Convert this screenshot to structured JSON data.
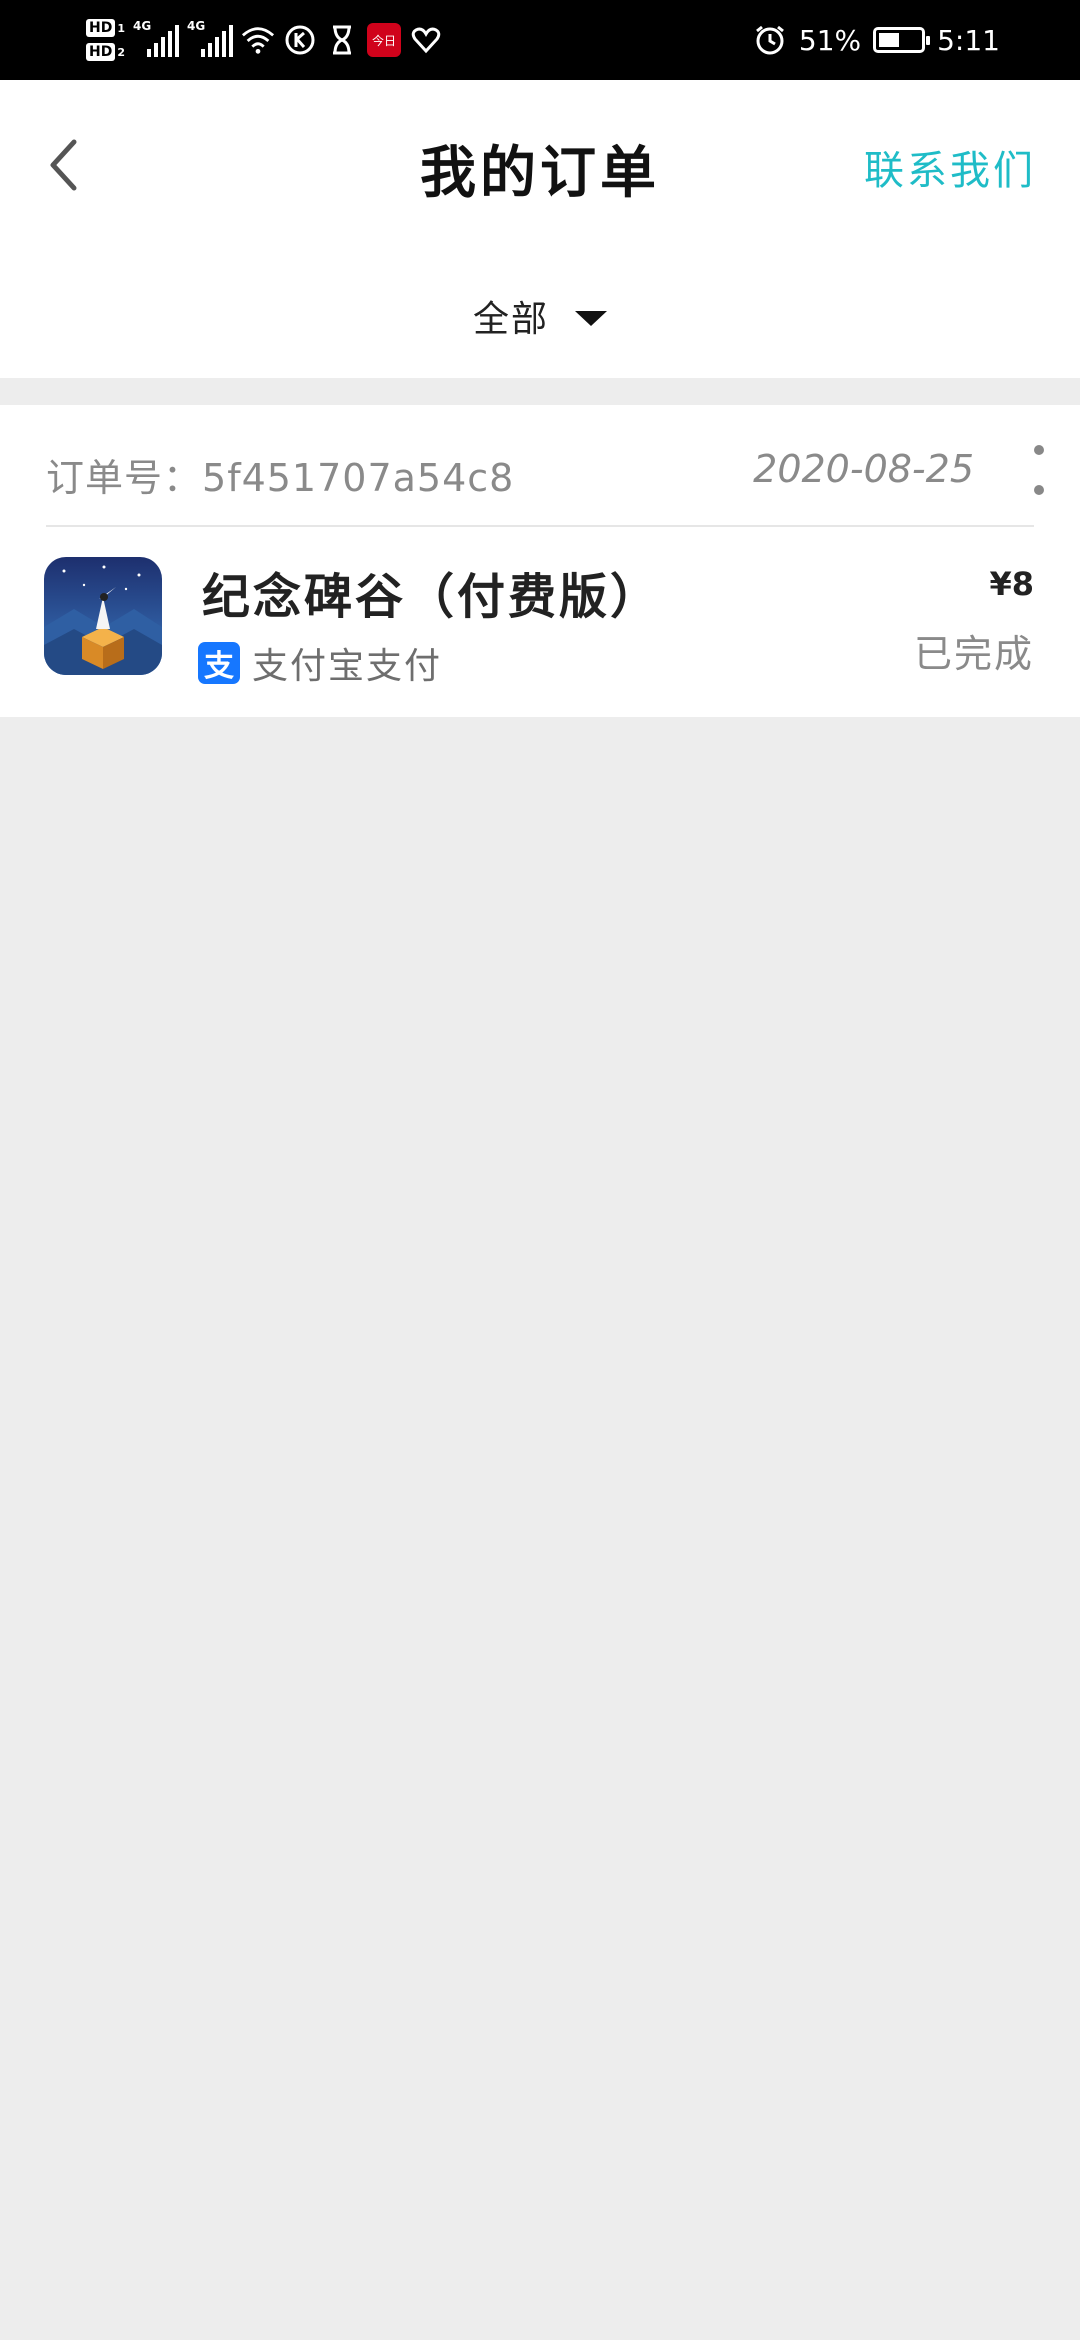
{
  "status_bar": {
    "hd1": "HD",
    "hd1_sub": "1",
    "hd2": "HD",
    "hd2_sub": "2",
    "net1": "4G",
    "net2": "4G",
    "red_app_text": "今日",
    "battery_percent": "51%",
    "battery_level": 0.51,
    "time": "5:11"
  },
  "header": {
    "title": "我的订单",
    "contact_label": "联系我们",
    "filter_label": "全部"
  },
  "colors": {
    "accent": "#1fbcc7",
    "background": "#ededed",
    "alipay": "#1677ff"
  },
  "orders": [
    {
      "order_no_label": "订单号：",
      "order_no": "5f451707a54c8",
      "date": "2020-08-25",
      "product_name": "纪念碑谷（付费版）",
      "payment_icon": "支",
      "payment_method": "支付宝支付",
      "price": "¥8",
      "status": "已完成"
    }
  ]
}
